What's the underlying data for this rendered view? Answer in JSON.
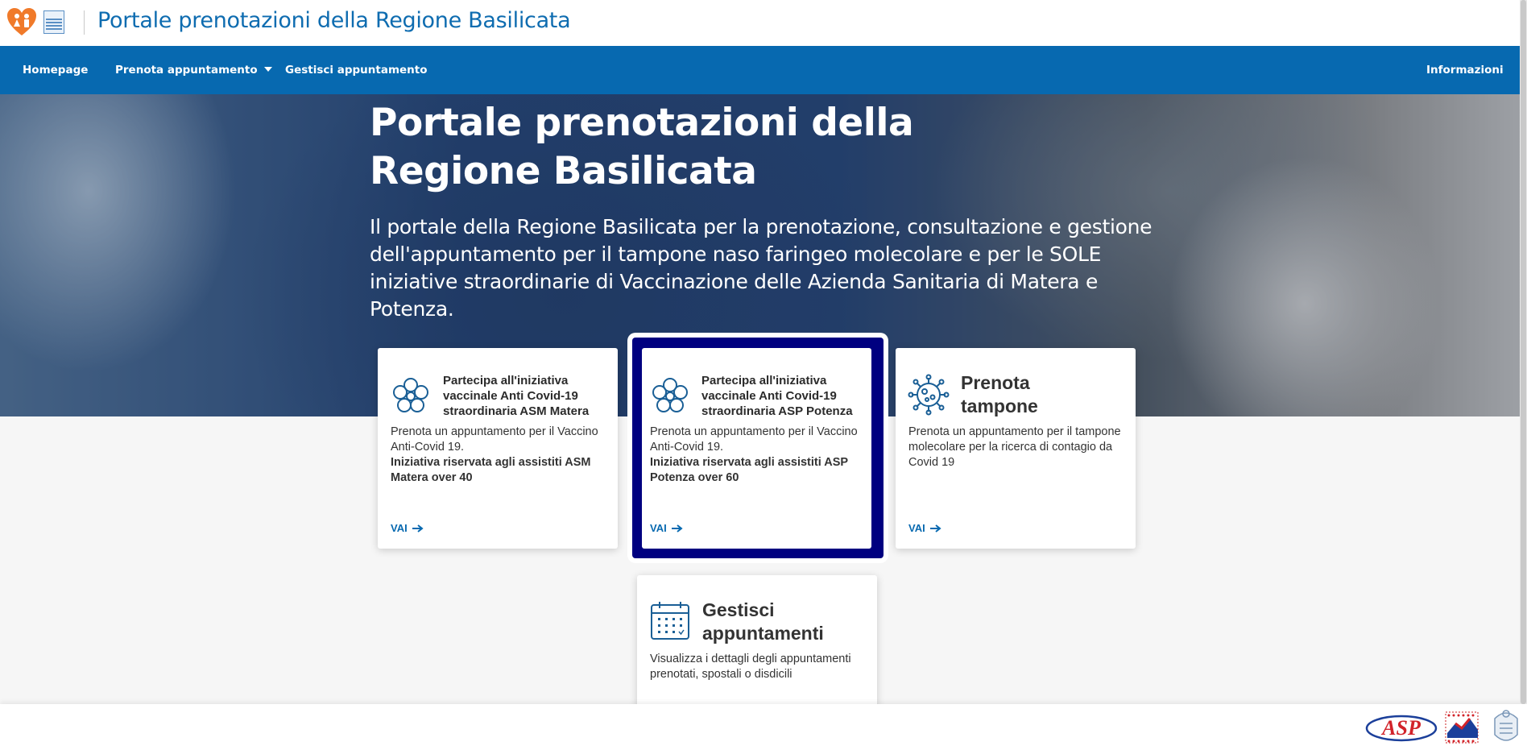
{
  "header": {
    "site_title": "Portale prenotazioni della Regione Basilicata"
  },
  "nav": {
    "items": [
      {
        "label": "Homepage"
      },
      {
        "label": "Prenota appuntamento",
        "has_dropdown": true
      },
      {
        "label": "Gestisci appuntamento"
      },
      {
        "label": "Informazioni"
      }
    ]
  },
  "hero": {
    "title": "Portale prenotazioni della Regione Basilicata",
    "subtitle": "Il portale della Regione Basilicata per la prenotazione, consultazione e gestione dell'appuntamento per il tampone naso faringeo molecolare e per le SOLE iniziative straordinarie di Vaccinazione delle Azienda Sanitaria di Matera e Potenza."
  },
  "cards": [
    {
      "icon": "flower-icon",
      "title": "Partecipa all'iniziativa vaccinale Anti Covid-19 straordinaria ASM Matera",
      "text": "Prenota un appuntamento per il Vaccino Anti-Covid 19.",
      "text_bold": "Iniziativa riservata agli assistiti ASM Matera over 40",
      "link": "VAI"
    },
    {
      "icon": "flower-icon",
      "title": "Partecipa all'iniziativa vaccinale Anti Covid-19 straordinaria ASP Potenza",
      "text": "Prenota un appuntamento per il Vaccino Anti-Covid 19.",
      "text_bold": "Iniziativa riservata agli assistiti ASP Potenza over 60",
      "link": "VAI",
      "focused": true
    },
    {
      "icon": "virus-icon",
      "title": "Prenota tampone",
      "text": "Prenota un appuntamento per il tampone molecolare per la ricerca di contagio da Covid 19",
      "link": "VAI"
    },
    {
      "icon": "calendar-icon",
      "title": "Gestisci appuntamenti",
      "text": "Visualizza i dettagli degli appuntamenti prenotati, spostali o disdicili"
    }
  ],
  "footer": {
    "logos": [
      "ASP",
      "asm-logo",
      "regione-basilicata-logo"
    ],
    "asp_text": "ASP"
  },
  "colors": {
    "brand_blue": "#0769b0",
    "focus_navy": "#000080"
  }
}
